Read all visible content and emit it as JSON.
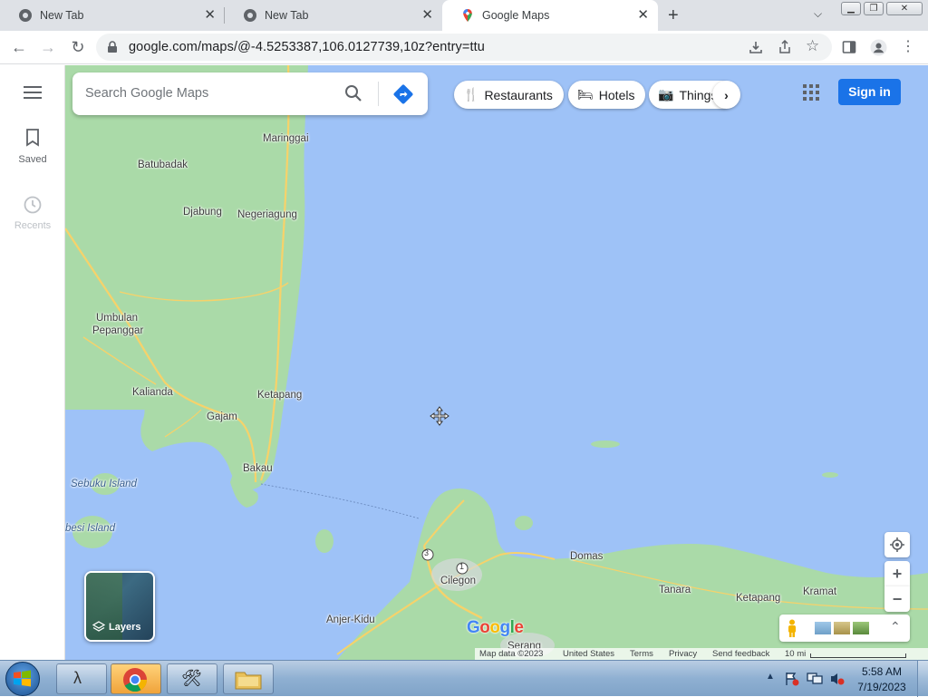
{
  "browser": {
    "tabs": [
      {
        "title": "New Tab",
        "active": false
      },
      {
        "title": "New Tab",
        "active": false
      },
      {
        "title": "Google Maps",
        "active": true
      }
    ],
    "url": "google.com/maps/@-4.5253387,106.0127739,10z?entry=ttu"
  },
  "maps": {
    "rail": {
      "saved": "Saved",
      "recents": "Recents"
    },
    "search": {
      "placeholder": "Search Google Maps"
    },
    "chips": [
      {
        "label": "Restaurants",
        "icon": "fork-knife-icon"
      },
      {
        "label": "Hotels",
        "icon": "bed-icon"
      },
      {
        "label": "Things",
        "icon": "camera-icon"
      }
    ],
    "signin": "Sign in",
    "layers": "Layers",
    "logo": "Google",
    "labels": {
      "maringgai": "Maringgai",
      "batubadak": "Batubadak",
      "djabung": "Djabung",
      "negeriagung": "Negeriagung",
      "umbulan": "Umbulan",
      "pepanggar": "Pepanggar",
      "kalianda": "Kalianda",
      "ketapang1": "Ketapang",
      "gajam": "Gajam",
      "bakau": "Bakau",
      "sebuku": "Sebuku Island",
      "sebesi": "besi Island",
      "domas": "Domas",
      "cilegon": "Cilegon",
      "tanara": "Tanara",
      "ketapang2": "Ketapang",
      "kramat": "Kramat",
      "anjer": "Anjer-Kidu",
      "serang": "Serang",
      "road3": "3",
      "road1": "1"
    },
    "footer": {
      "mapdata": "Map data ©2023",
      "country": "United States",
      "terms": "Terms",
      "privacy": "Privacy",
      "feedback": "Send feedback",
      "scale": "10 mi"
    }
  },
  "taskbar": {
    "time": "5:58 AM",
    "date": "7/19/2023"
  },
  "colors": {
    "water": "#9ec2f7",
    "land": "#aadaa8",
    "road": "#f7d26a",
    "accent": "#1a73e8"
  }
}
